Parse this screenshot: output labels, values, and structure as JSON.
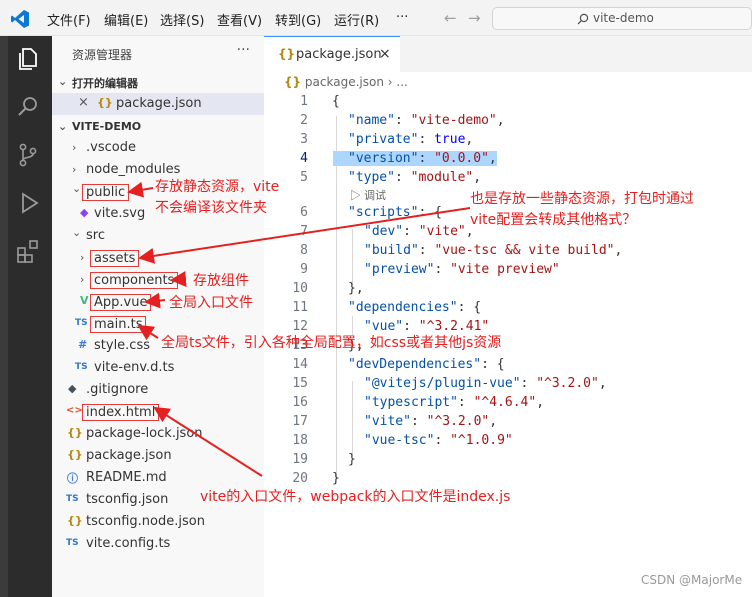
{
  "titlebar": {
    "menus": [
      "文件(F)",
      "编辑(E)",
      "选择(S)",
      "查看(V)",
      "转到(G)",
      "运行(R)"
    ],
    "more": "···",
    "back": "←",
    "forward": "→",
    "search": "vite-demo"
  },
  "sidebar": {
    "title": "资源管理器",
    "more": "···",
    "open_editors": "打开的编辑器",
    "open_file": "package.json",
    "project": "VITE-DEMO",
    "items": [
      {
        "name": ".vscode",
        "icon": "›"
      },
      {
        "name": "node_modules",
        "icon": "›"
      },
      {
        "name": "public",
        "icon": "⌄"
      },
      {
        "name": "vite.svg",
        "icon": "◆"
      },
      {
        "name": "src",
        "icon": "⌄"
      },
      {
        "name": "assets",
        "icon": "›"
      },
      {
        "name": "components",
        "icon": "›"
      },
      {
        "name": "App.vue",
        "icon": "V"
      },
      {
        "name": "main.ts",
        "icon": "TS"
      },
      {
        "name": "style.css",
        "icon": "#"
      },
      {
        "name": "vite-env.d.ts",
        "icon": "TS"
      },
      {
        "name": ".gitignore",
        "icon": "◆"
      },
      {
        "name": "index.html",
        "icon": "<>"
      },
      {
        "name": "package-lock.json",
        "icon": "{}"
      },
      {
        "name": "package.json",
        "icon": "{}"
      },
      {
        "name": "README.md",
        "icon": "ⓘ"
      },
      {
        "name": "tsconfig.json",
        "icon": "TS"
      },
      {
        "name": "tsconfig.node.json",
        "icon": "{}"
      },
      {
        "name": "vite.config.ts",
        "icon": "TS"
      }
    ]
  },
  "editor": {
    "tab": "package.json",
    "tab_close": "×",
    "breadcrumb_file": "package.json",
    "breadcrumb_more": "›  ...",
    "debug_hint": "▷ 调试",
    "line_numbers": [
      "1",
      "2",
      "3",
      "4",
      "5",
      "6",
      "7",
      "8",
      "9",
      "10",
      "11",
      "12",
      "13",
      "14",
      "15",
      "16",
      "17",
      "18",
      "19",
      "20"
    ],
    "code": {
      "l1": "{",
      "name_key": "\"name\"",
      "name_val": "\"vite-demo\"",
      "private_key": "\"private\"",
      "private_val": "true",
      "version_key": "\"version\"",
      "version_val": "\"0.0.0\"",
      "type_key": "\"type\"",
      "type_val": "\"module\"",
      "scripts_key": "\"scripts\"",
      "dev_key": "\"dev\"",
      "dev_val": "\"vite\"",
      "build_key": "\"build\"",
      "build_val": "\"vue-tsc && vite build\"",
      "preview_key": "\"preview\"",
      "preview_val": "\"vite preview\"",
      "dependencies_key": "\"dependencies\"",
      "vue_key": "\"vue\"",
      "vue_val": "\"^3.2.41\"",
      "devdeps_key": "\"devDependencies\"",
      "plugin_key": "\"@vitejs/plugin-vue\"",
      "plugin_val": "\"^3.2.0\"",
      "typescript_key": "\"typescript\"",
      "typescript_val": "\"^4.6.4\"",
      "vite_key": "\"vite\"",
      "vite_val": "\"^3.2.0\"",
      "vuetsc_key": "\"vue-tsc\"",
      "vuetsc_val": "\"^1.0.9\""
    }
  },
  "annotations": {
    "public_1": "存放静态资源，vite",
    "public_2": "不会编译该文件夹",
    "assets_1": "也是存放一些静态资源，打包时通过",
    "assets_2": "vite配置会转成其他格式？",
    "components": "存放组件",
    "app": "全局入口文件",
    "main": "全局ts文件，引入各种全局配置，如css或者其他js资源",
    "index": "vite的入口文件，webpack的入口文件是index.js"
  },
  "watermark": "CSDN @MajorMe",
  "colors": {
    "accent": "#3794ff",
    "annotation": "#e42020",
    "highlight": "#add6ff"
  }
}
